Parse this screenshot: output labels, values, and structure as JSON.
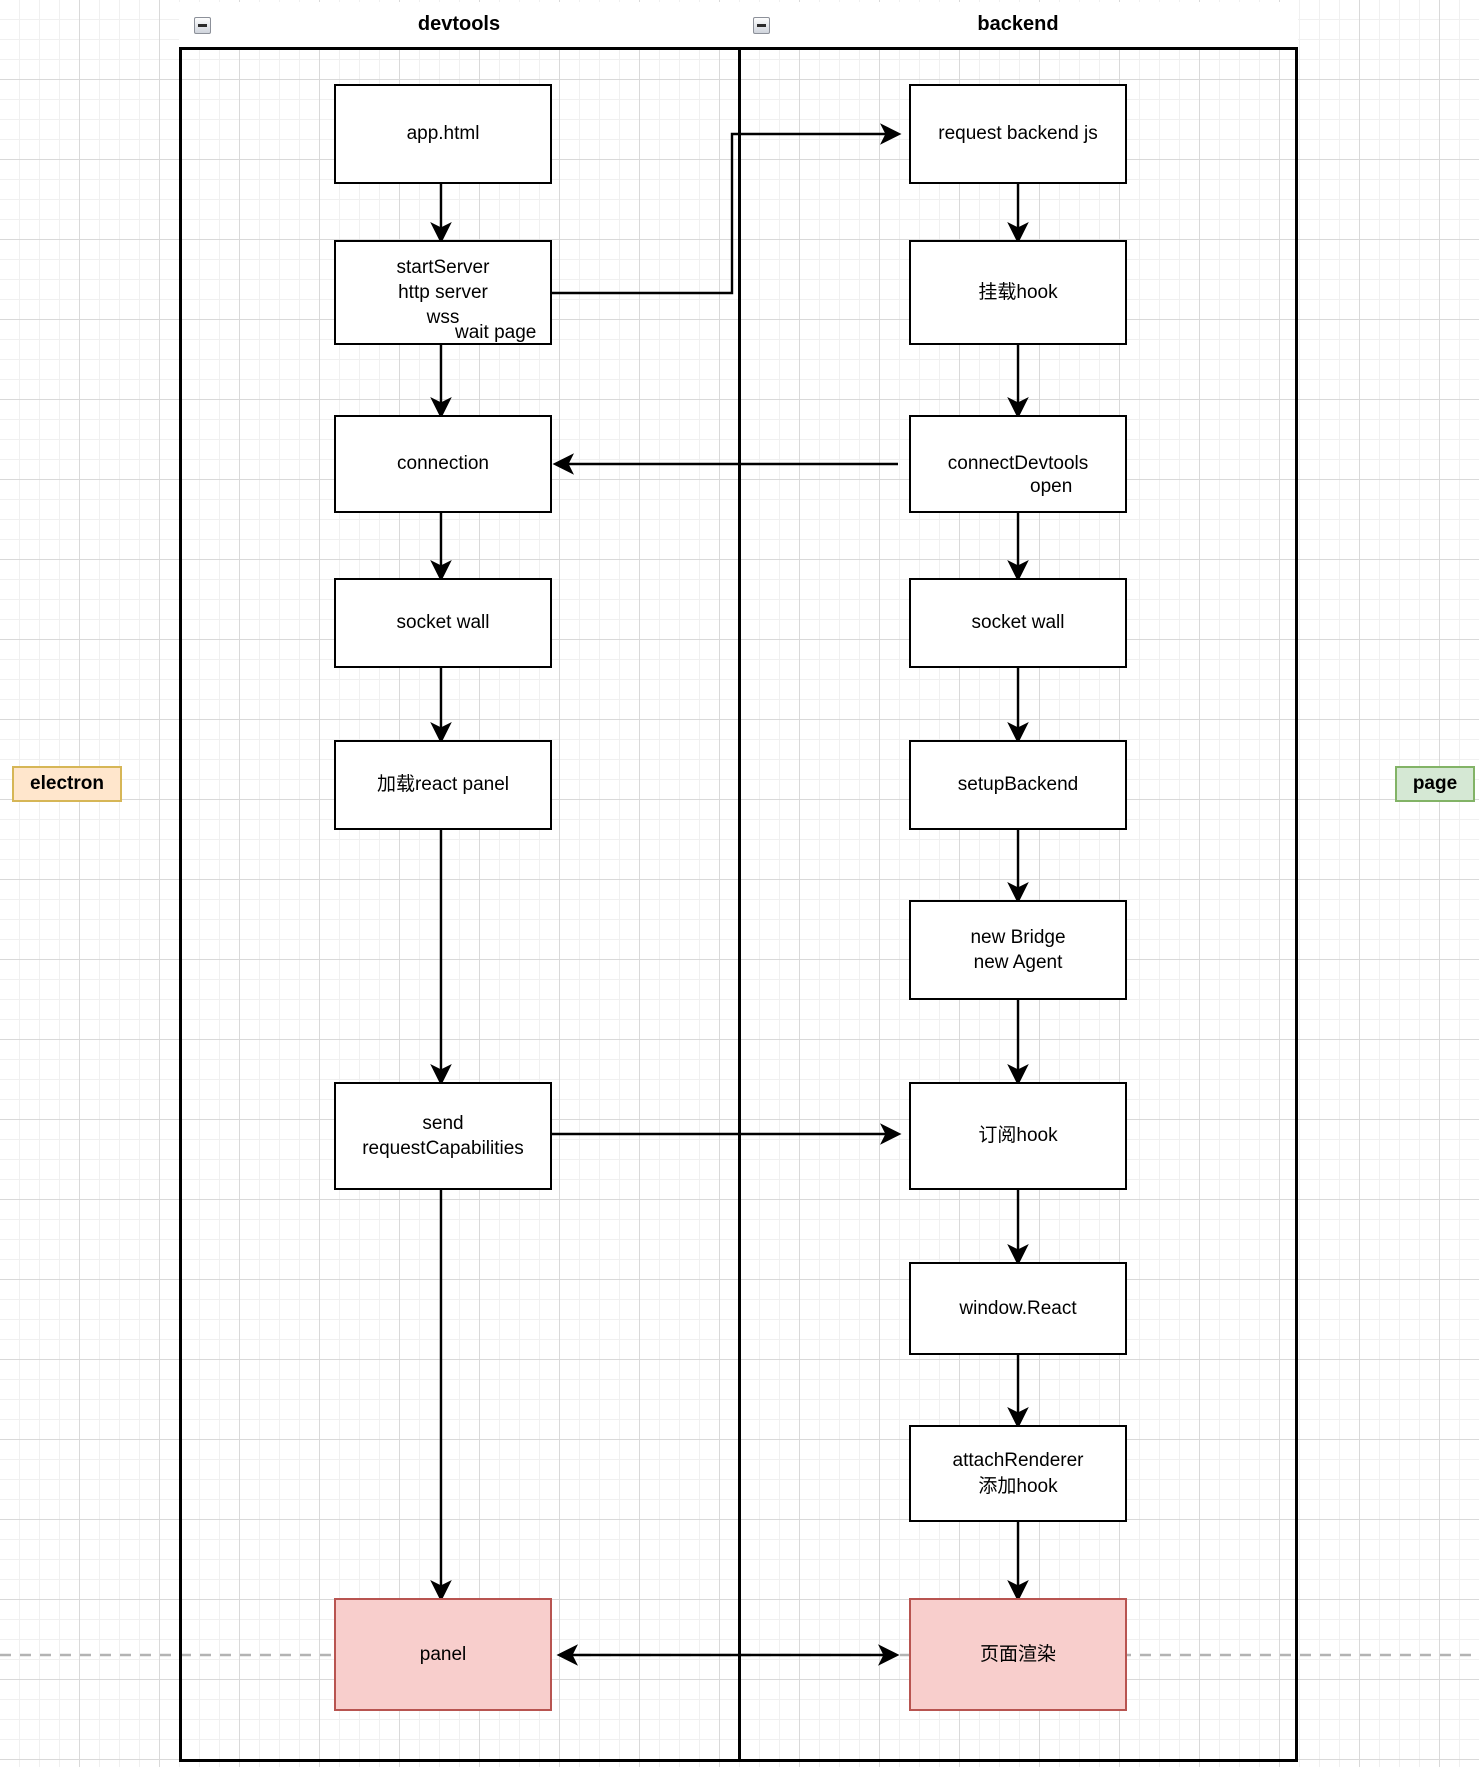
{
  "diagram": {
    "title": "react devtools electron architecture flow",
    "background": "graph-paper",
    "tags": [
      {
        "id": "electron",
        "label": "electron",
        "border_color": "#d6b656",
        "fill_color": "#ffe6cc"
      },
      {
        "id": "page",
        "label": "page",
        "border_color": "#82b366",
        "fill_color": "#d5e8d4"
      }
    ],
    "pool": {
      "lanes": [
        {
          "id": "devtools",
          "label": "devtools",
          "collapse_icon": "minus-square-icon"
        },
        {
          "id": "backend",
          "label": "backend",
          "collapse_icon": "minus-square-icon"
        }
      ]
    },
    "nodes": [
      {
        "id": "app-html",
        "lane": "devtools",
        "label": "app.html",
        "style": "default"
      },
      {
        "id": "start-server",
        "lane": "devtools",
        "label": "startServer\nhttp server\nwss",
        "style": "default"
      },
      {
        "id": "connection",
        "lane": "devtools",
        "label": "connection",
        "style": "default"
      },
      {
        "id": "socket-wall-devtools",
        "lane": "devtools",
        "label": "socket wall",
        "style": "default"
      },
      {
        "id": "load-react-panel",
        "lane": "devtools",
        "label": "加载react panel",
        "style": "default"
      },
      {
        "id": "send-request-capabilities",
        "lane": "devtools",
        "label": "send\nrequestCapabilities",
        "style": "default"
      },
      {
        "id": "panel",
        "lane": "devtools",
        "label": "panel",
        "style": "highlight"
      },
      {
        "id": "request-backend-js",
        "lane": "backend",
        "label": "request backend js",
        "style": "default"
      },
      {
        "id": "mount-hook",
        "lane": "backend",
        "label": "挂载hook",
        "style": "default"
      },
      {
        "id": "connect-devtools",
        "lane": "backend",
        "label": "connectDevtools",
        "style": "default"
      },
      {
        "id": "socket-wall-backend",
        "lane": "backend",
        "label": "socket wall",
        "style": "default"
      },
      {
        "id": "setup-backend",
        "lane": "backend",
        "label": "setupBackend",
        "style": "default"
      },
      {
        "id": "new-bridge-agent",
        "lane": "backend",
        "label": "new Bridge\nnew Agent",
        "style": "default"
      },
      {
        "id": "subscribe-hook",
        "lane": "backend",
        "label": "订阅hook",
        "style": "default"
      },
      {
        "id": "window-react",
        "lane": "backend",
        "label": "window.React",
        "style": "default"
      },
      {
        "id": "attach-renderer",
        "lane": "backend",
        "label": "attachRenderer\n添加hook",
        "style": "default"
      },
      {
        "id": "page-render",
        "lane": "backend",
        "label": "页面渲染",
        "style": "highlight"
      }
    ],
    "edges": [
      {
        "from": "app-html",
        "to": "start-server",
        "label": ""
      },
      {
        "from": "start-server",
        "to": "connection",
        "label": "wait page"
      },
      {
        "from": "start-server",
        "to": "request-backend-js",
        "label": ""
      },
      {
        "from": "connection",
        "to": "socket-wall-devtools",
        "label": ""
      },
      {
        "from": "socket-wall-devtools",
        "to": "load-react-panel",
        "label": ""
      },
      {
        "from": "load-react-panel",
        "to": "send-request-capabilities",
        "label": ""
      },
      {
        "from": "send-request-capabilities",
        "to": "subscribe-hook",
        "label": ""
      },
      {
        "from": "send-request-capabilities",
        "to": "panel",
        "label": ""
      },
      {
        "from": "request-backend-js",
        "to": "mount-hook",
        "label": ""
      },
      {
        "from": "mount-hook",
        "to": "connect-devtools",
        "label": ""
      },
      {
        "from": "connect-devtools",
        "to": "connection",
        "label": ""
      },
      {
        "from": "connect-devtools",
        "to": "socket-wall-backend",
        "label": "open"
      },
      {
        "from": "socket-wall-backend",
        "to": "setup-backend",
        "label": ""
      },
      {
        "from": "setup-backend",
        "to": "new-bridge-agent",
        "label": ""
      },
      {
        "from": "new-bridge-agent",
        "to": "subscribe-hook",
        "label": ""
      },
      {
        "from": "subscribe-hook",
        "to": "window-react",
        "label": ""
      },
      {
        "from": "window-react",
        "to": "attach-renderer",
        "label": ""
      },
      {
        "from": "attach-renderer",
        "to": "page-render",
        "label": ""
      },
      {
        "from": "panel",
        "to": "page-render",
        "label": "",
        "style": "bidirectional"
      }
    ],
    "labels": {
      "wait_page": "wait page",
      "open": "open"
    }
  }
}
